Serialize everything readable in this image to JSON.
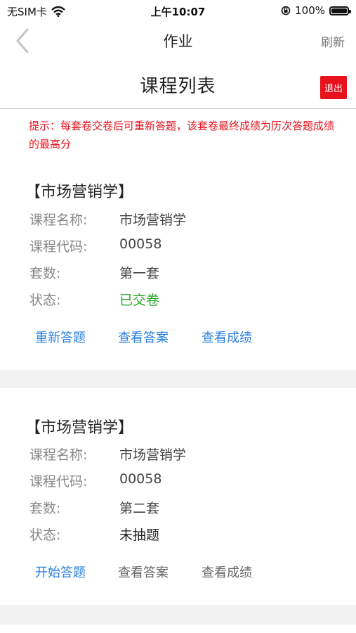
{
  "status_bar": {
    "carrier": "无SIM卡",
    "time": "上午10:07",
    "battery": "100%",
    "icons": [
      "wifi-icon",
      "lock-rotation-icon",
      "battery-icon"
    ]
  },
  "nav": {
    "title": "作业",
    "refresh_label": "刷新",
    "back_icon": "chevron-left-icon"
  },
  "page": {
    "title": "课程列表",
    "logout_label": "退出"
  },
  "notice": "提示：每套卷交卷后可重新答题，该套卷最终成绩为历次答题成绩的最高分",
  "labels": {
    "course_name": "课程名称:",
    "course_code": "课程代码:",
    "set": "套数:",
    "status": "状态:"
  },
  "courses": [
    {
      "heading": "【市场营销学】",
      "course_name": "市场营销学",
      "course_code": "00058",
      "set": "第一套",
      "status": "已交卷",
      "status_color": "#2aa52a",
      "actions": [
        "重新答题",
        "查看答案",
        "查看成绩"
      ]
    },
    {
      "heading": "【市场营销学】",
      "course_name": "市场营销学",
      "course_code": "00058",
      "set": "第二套",
      "status": "未抽题",
      "status_color": "#222222",
      "actions": [
        "开始答题",
        "查看答案",
        "查看成绩"
      ]
    }
  ],
  "colors": {
    "accent_red": "#e8121c",
    "link_blue": "#2a7fdf",
    "separator_gray": "#f2f2f2"
  }
}
